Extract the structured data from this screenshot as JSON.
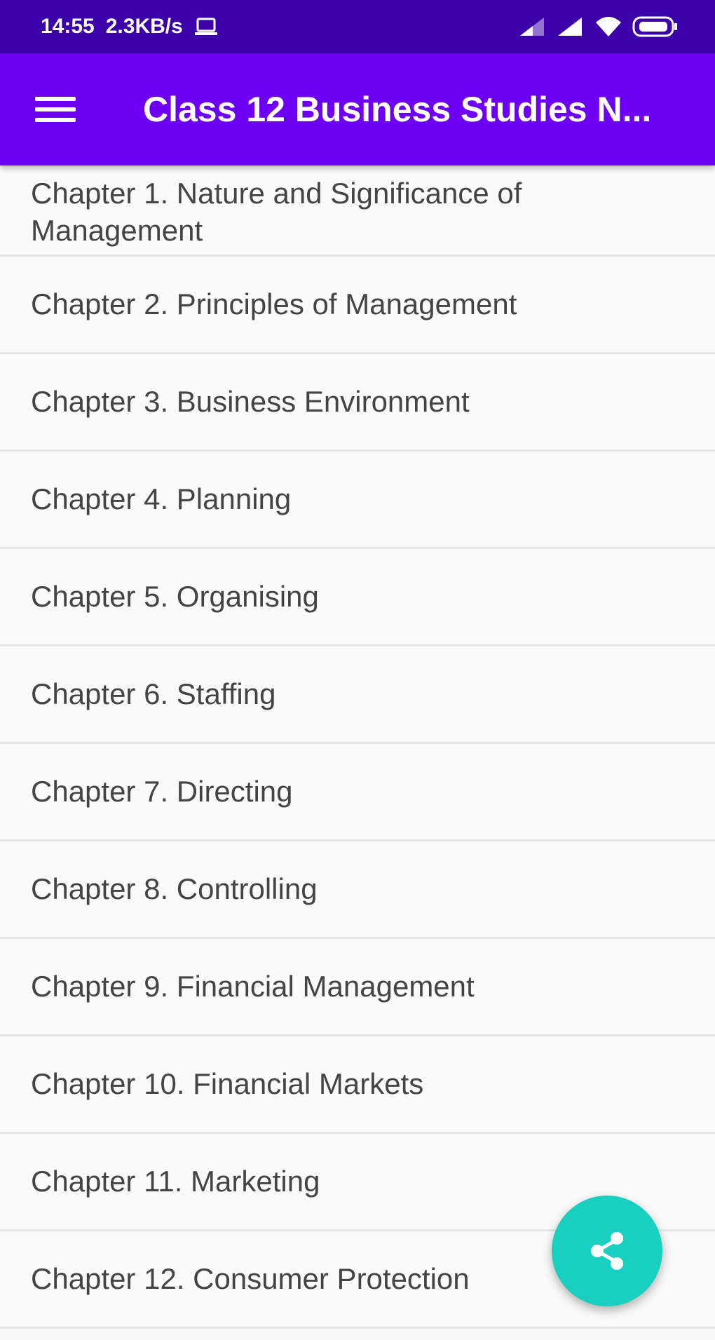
{
  "status_bar": {
    "time": "14:55",
    "speed": "2.3KB/s"
  },
  "app_bar": {
    "title": "Class 12 Business Studies N..."
  },
  "chapters": [
    "Chapter 1. Nature and Significance of Management",
    "Chapter 2. Principles of Management",
    "Chapter 3. Business Environment",
    "Chapter 4. Planning",
    "Chapter 5. Organising",
    "Chapter 6. Staffing",
    "Chapter 7. Directing",
    "Chapter 8. Controlling",
    "Chapter 9. Financial Management",
    "Chapter 10. Financial Markets",
    "Chapter 11. Marketing",
    "Chapter 12. Consumer Protection"
  ],
  "colors": {
    "status_bar": "#3a02a8",
    "app_bar": "#6d00f2",
    "fab": "#19cfc0"
  },
  "icons": {
    "menu": "hamburger-menu-icon",
    "fab": "share-icon"
  }
}
